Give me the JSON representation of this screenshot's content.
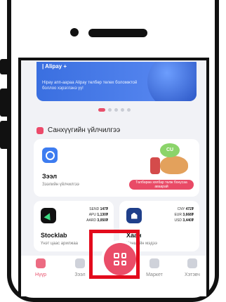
{
  "banner": {
    "brand": "| Alipay +",
    "text": "Hipay апп-аараа Alipay төлбөр төлөх боломжтой боллоо хэрэглэнэ үү!"
  },
  "carousel": {
    "active_index": 0,
    "total": 5
  },
  "services": {
    "title": "Санхүүгийн үйлчилгээ"
  },
  "loan_card": {
    "title": "Зээл",
    "subtitle": "Зээлийн үйлчилгээ",
    "promo": "Төлбөрөө хялбар төлж бонусаа аваарай",
    "badge": "CU"
  },
  "stock_card": {
    "title": "Stocklab",
    "subtitle": "Үнэт цаас арилжаа",
    "rows": [
      {
        "ticker": "SEND",
        "value": "147₮"
      },
      {
        "ticker": "APU",
        "value": "1,130₮"
      },
      {
        "ticker": "AARD",
        "value": "3,050₮"
      }
    ]
  },
  "bank_card": {
    "title": "Хаан",
    "subtitle": "Ханшийн мэдээ",
    "rows": [
      {
        "ticker": "CNY",
        "value": "472₮"
      },
      {
        "ticker": "EUR",
        "value": "3,668₮"
      },
      {
        "ticker": "USD",
        "value": "3,440₮"
      }
    ]
  },
  "tabs": [
    {
      "label": "Нүүр",
      "active": true
    },
    {
      "label": "Зээл",
      "active": false
    },
    {
      "label": "",
      "active": false
    },
    {
      "label": "Маркет",
      "active": false
    },
    {
      "label": "Хэтэвч",
      "active": false
    }
  ],
  "colors": {
    "accent": "#e84f6a",
    "highlight": "#e30b1c",
    "banner": "#3a6fe0"
  }
}
